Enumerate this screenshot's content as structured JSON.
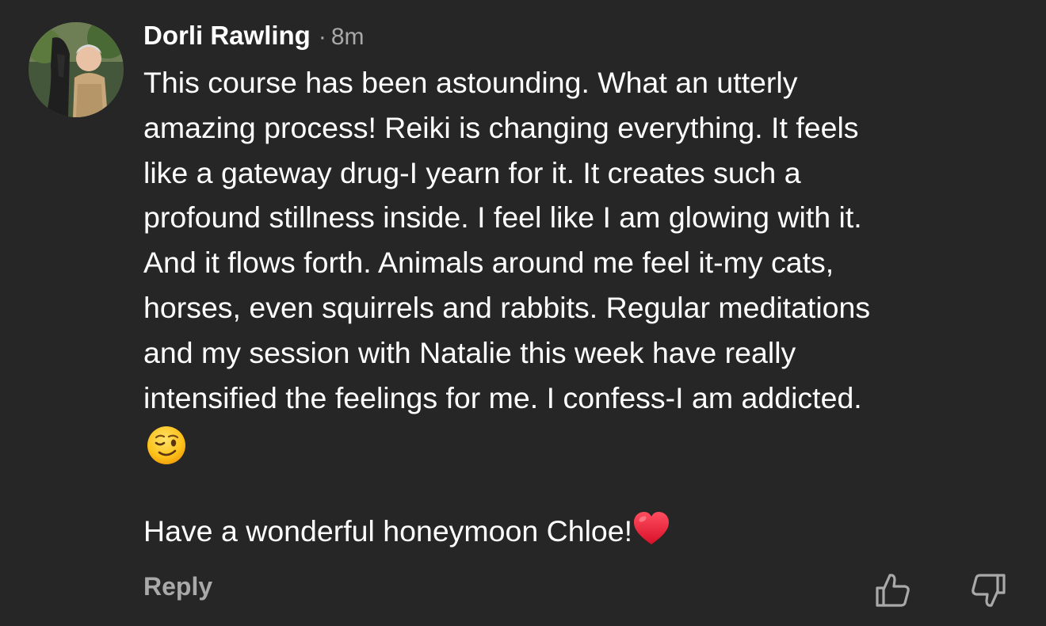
{
  "comment": {
    "author": "Dorli Rawling",
    "separator": "·",
    "timestamp": "8m",
    "lines": [
      "This course has been astounding. What an utterly",
      "amazing process! Reiki is changing everything. It feels",
      "like a gateway drug-I yearn for it. It creates such a",
      "profound stillness inside. I feel like I am glowing with it.",
      "And it flows forth. Animals around me feel it-my cats,",
      "horses, even squirrels and rabbits. Regular meditations",
      "and my session with Natalie this week have really",
      "intensified the feelings for me. I confess-I am addicted."
    ],
    "emoji": "winking-face-emoji",
    "closing": "Have a wonderful honeymoon Chloe!",
    "closing_emoji": "red-heart-emoji"
  },
  "actions": {
    "reply_label": "Reply",
    "like_icon": "thumbs-up-icon",
    "dislike_icon": "thumbs-down-icon"
  },
  "colors": {
    "background": "#262626",
    "text": "#ffffff",
    "muted": "#a9a9a9"
  }
}
